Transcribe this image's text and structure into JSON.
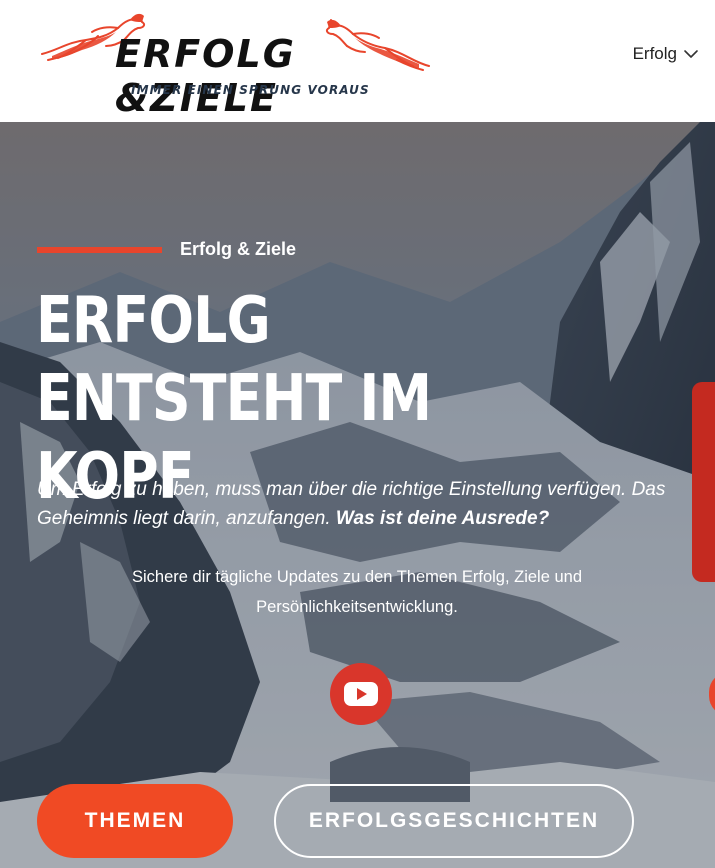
{
  "header": {
    "logo": {
      "title": "ERFOLG &ZIELE",
      "tagline": "IMMER EINEN SPRUNG VORAUS",
      "icon": "leaping-animal-icon",
      "accent_color": "#e8452c"
    },
    "nav": {
      "label": "Erfolg",
      "icon": "chevron-down-icon"
    }
  },
  "hero": {
    "eyebrow": "Erfolg & Ziele",
    "headline": "ERFOLG ENTSTEHT IM KOPF",
    "subtext_main": "Um Erfolg zu haben, muss man über die richtige Einstellung verfügen. Das Geheimnis liegt darin, anzufangen.",
    "subtext_bold": "Was ist deine Ausrede?",
    "updates_text": "Sichere dir tägliche Updates zu den Themen Erfolg, Ziele und Persönlichkeitsentwicklung.",
    "youtube_icon": "youtube-icon",
    "buttons": {
      "primary": "THEMEN",
      "secondary": "ERFOLGSGESCHICHTEN"
    },
    "colors": {
      "accent": "#e8452c",
      "primary_button": "#f04a24",
      "youtube": "#d9362b"
    }
  }
}
